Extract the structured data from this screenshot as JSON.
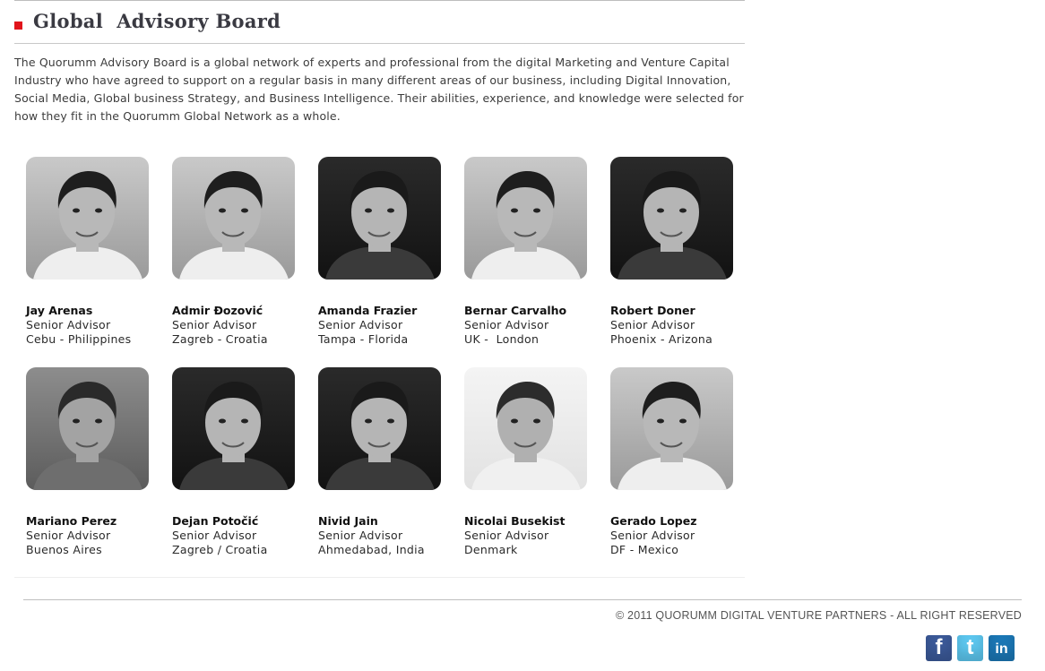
{
  "header": {
    "title": "Global  Advisory Board",
    "accent_color": "#e1141b"
  },
  "intro": {
    "text": "The Quorumm Advisory Board is a global network of experts and professional from the digital Marketing and Venture Capital Industry who have agreed to support on a regular basis in many different areas of our business, including Digital Innovation, Social Media, Global business Strategy, and Business Intelligence. Their abilities, experience, and knowledge were selected for how they fit in the Quorumm Global Network as a whole."
  },
  "advisors": [
    {
      "name": "Jay Arenas",
      "role": "Senior Advisor",
      "location": "Cebu - Philippines",
      "photo_tone": "light"
    },
    {
      "name": "Admir Đozović",
      "role": "Senior Advisor",
      "location": "Zagreb - Croatia",
      "photo_tone": "light"
    },
    {
      "name": "Amanda Frazier",
      "role": "Senior Advisor",
      "location": "Tampa - Florida",
      "photo_tone": "dark"
    },
    {
      "name": "Bernar Carvalho",
      "role": "Senior Advisor",
      "location": "UK -  London",
      "photo_tone": "light"
    },
    {
      "name": "Robert Doner",
      "role": "Senior Advisor",
      "location": "Phoenix - Arizona",
      "photo_tone": "dark"
    },
    {
      "name": "Mariano Perez",
      "role": "Senior Advisor",
      "location": "Buenos Aires",
      "photo_tone": "mid"
    },
    {
      "name": "Dejan Potočić",
      "role": "Senior Advisor",
      "location": "Zagreb / Croatia",
      "photo_tone": "dark"
    },
    {
      "name": "Nivid Jain",
      "role": "Senior Advisor",
      "location": "Ahmedabad, India",
      "photo_tone": "dark"
    },
    {
      "name": "Nicolai Busekist",
      "role": "Senior Advisor",
      "location": "Denmark",
      "photo_tone": "white"
    },
    {
      "name": "Gerado Lopez",
      "role": "Senior Advisor",
      "location": "DF - Mexico",
      "photo_tone": "light"
    }
  ],
  "footer": {
    "copyright": "© 2011 QUORUMM DIGITAL VENTURE PARTNERS - ALL RIGHT RESERVED"
  },
  "social": [
    {
      "icon": "facebook-icon",
      "glyph": "f",
      "color": "#3b5998"
    },
    {
      "icon": "twitter-icon",
      "glyph": "t",
      "color": "#5cc6ee"
    },
    {
      "icon": "linkedin-icon",
      "glyph": "in",
      "color": "#1b77b5"
    }
  ]
}
